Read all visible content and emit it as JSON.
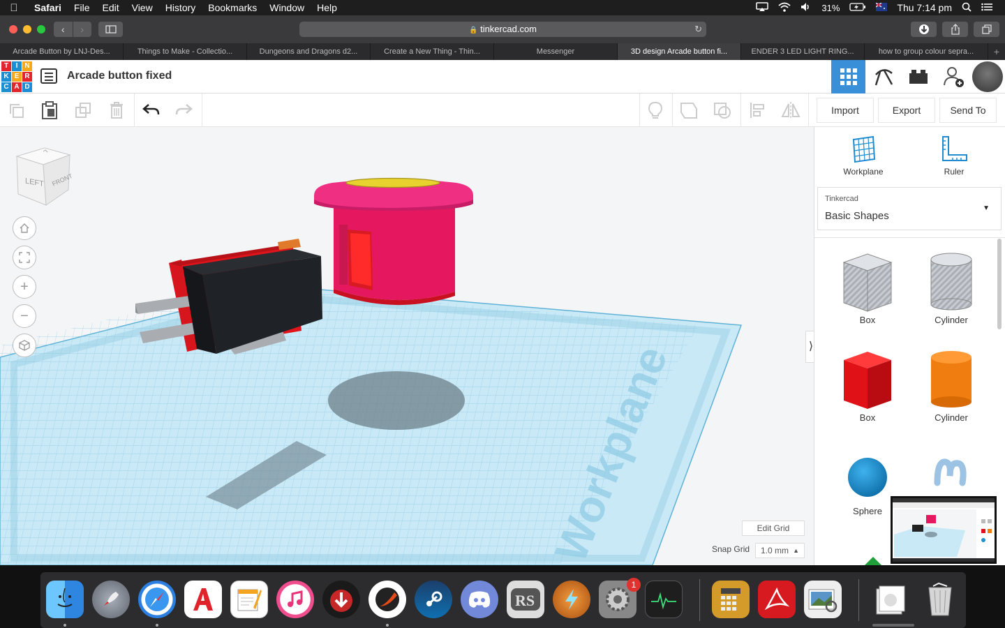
{
  "menubar": {
    "app": "Safari",
    "items": [
      "File",
      "Edit",
      "View",
      "History",
      "Bookmarks",
      "Window",
      "Help"
    ],
    "battery": "31%",
    "clock": "Thu 7:14 pm"
  },
  "browser": {
    "url": "tinkercad.com",
    "tabs": [
      "Arcade Button by LNJ-Des...",
      "Things to Make - Collectio...",
      "Dungeons and Dragons d2...",
      "Create a New Thing - Thin...",
      "Messenger",
      "3D design Arcade button fi...",
      "ENDER 3 LED LIGHT RING...",
      "how to group colour sepra..."
    ],
    "active_tab": 5
  },
  "tinkercad": {
    "logo_letters": [
      "T",
      "I",
      "N",
      "K",
      "E",
      "R",
      "C",
      "A",
      "D"
    ],
    "design_title": "Arcade button fixed",
    "actions": {
      "import": "Import",
      "export": "Export",
      "send_to": "Send To"
    },
    "viewcube": {
      "left": "LEFT",
      "front": "FRONT"
    },
    "workspace": {
      "workplane_watermark": "Workplane",
      "edit_grid": "Edit Grid",
      "snap_grid_label": "Snap Grid",
      "snap_grid_value": "1.0 mm"
    },
    "panel": {
      "workplane_label": "Workplane",
      "ruler_label": "Ruler",
      "library_source": "Tinkercad",
      "library_name": "Basic Shapes",
      "shapes": [
        {
          "label": "Box",
          "color": "#b8bcc4"
        },
        {
          "label": "Cylinder",
          "color": "#b8bcc4"
        },
        {
          "label": "Box",
          "color": "#e0161c"
        },
        {
          "label": "Cylinder",
          "color": "#f07d10"
        },
        {
          "label": "Sphere",
          "color": "#1e8fcf"
        },
        {
          "label": "",
          "color": "#8ab4d8"
        }
      ]
    }
  },
  "dock": {
    "apps": [
      {
        "name": "finder",
        "color": "#3b8fe8",
        "running": true
      },
      {
        "name": "launchpad",
        "color": "#8a8f99",
        "running": false
      },
      {
        "name": "safari",
        "color": "#2a7fe0",
        "running": true
      },
      {
        "name": "autocad",
        "color": "#e0222a",
        "running": false
      },
      {
        "name": "pages",
        "color": "#f3a520",
        "running": false
      },
      {
        "name": "itunes",
        "color": "#f04d8e",
        "running": false
      },
      {
        "name": "downie",
        "color": "#c62828",
        "running": false
      },
      {
        "name": "slicer",
        "color": "#e64a19",
        "running": true
      },
      {
        "name": "steam",
        "color": "#1b3f6b",
        "running": false
      },
      {
        "name": "discord",
        "color": "#7289da",
        "running": false
      },
      {
        "name": "runescape",
        "color": "#9e9e9e",
        "running": false
      },
      {
        "name": "reeder",
        "color": "#e67e22",
        "running": false
      },
      {
        "name": "system-preferences",
        "color": "#888888",
        "running": false,
        "badge": "1"
      },
      {
        "name": "activity-monitor",
        "color": "#1e1e1e",
        "running": false
      },
      {
        "name": "calculator",
        "color": "#d49a2a",
        "running": false
      },
      {
        "name": "acrobat",
        "color": "#d71920",
        "running": false
      },
      {
        "name": "preview",
        "color": "#5b95c7",
        "running": false
      },
      {
        "name": "documents-stack",
        "color": "#dddddd",
        "running": false
      },
      {
        "name": "trash",
        "color": "#9a9a9a",
        "running": false
      }
    ]
  }
}
